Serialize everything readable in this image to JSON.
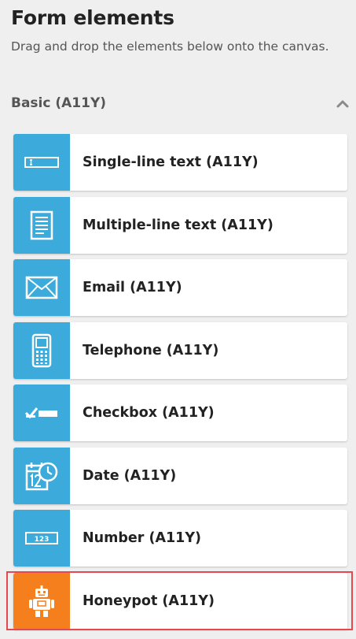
{
  "panel": {
    "title": "Form elements",
    "description": "Drag and drop the elements below onto the canvas."
  },
  "section": {
    "title": "Basic (A11Y)",
    "toggle_icon": "chevron-up-icon"
  },
  "items": [
    {
      "label": "Single-line text (A11Y)",
      "icon": "single-line-text-icon"
    },
    {
      "label": "Multiple-line text (A11Y)",
      "icon": "multiple-line-text-icon"
    },
    {
      "label": "Email (A11Y)",
      "icon": "email-icon"
    },
    {
      "label": "Telephone (A11Y)",
      "icon": "telephone-icon"
    },
    {
      "label": "Checkbox (A11Y)",
      "icon": "checkbox-icon"
    },
    {
      "label": "Date (A11Y)",
      "icon": "date-icon"
    },
    {
      "label": "Number (A11Y)",
      "icon": "number-icon",
      "icon_text": "123"
    },
    {
      "label": "Honeypot (A11Y)",
      "icon": "honeypot-robot-icon",
      "highlighted": true
    }
  ],
  "colors": {
    "icon_blue": "#3cabdb",
    "icon_orange": "#f57f1c",
    "highlight_border": "#e5484d"
  }
}
